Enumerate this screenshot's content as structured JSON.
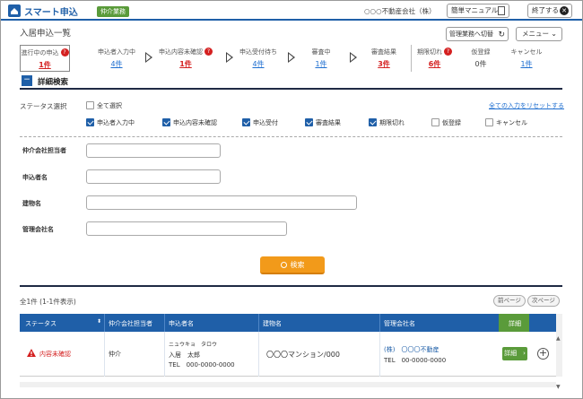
{
  "header": {
    "app_title": "スマート申込",
    "role_badge": "仲介業務",
    "company": "○○○不動産会社（株）",
    "manual_label": "簡単マニュアル",
    "exit_label": "終了する",
    "accent": "#1f5fa8"
  },
  "page": {
    "title": "入居申込一覧",
    "switch_label": "管理業務へ切替",
    "menu_label": "メニュー"
  },
  "status_tabs": [
    {
      "label": "進行中の申込",
      "count": "1件",
      "alert": true,
      "count_style": "red"
    },
    {
      "label": "申込者入力中",
      "count": "4件",
      "alert": false,
      "count_style": "link"
    },
    {
      "label": "申込内容未確認",
      "count": "1件",
      "alert": true,
      "count_style": "red"
    },
    {
      "label": "申込受付待ち",
      "count": "4件",
      "alert": false,
      "count_style": "link"
    },
    {
      "label": "審査中",
      "count": "1件",
      "alert": false,
      "count_style": "link"
    },
    {
      "label": "審査結果",
      "count": "3件",
      "alert": false,
      "count_style": "red"
    },
    {
      "label": "期限切れ",
      "count": "6件",
      "alert": true,
      "count_style": "red"
    },
    {
      "label": "仮登録",
      "count": "0件",
      "alert": false,
      "count_style": "plain"
    },
    {
      "label": "キャンセル",
      "count": "1件",
      "alert": false,
      "count_style": "link"
    }
  ],
  "alert_mark": "?",
  "detail_search": {
    "title": "詳細検索",
    "collapse_symbol": "−",
    "status_label": "ステータス選択",
    "reset_label": "全ての入力をリセットする",
    "select_all": "全て選択",
    "checkboxes": [
      {
        "label": "申込者入力中",
        "checked": true
      },
      {
        "label": "申込内容未確認",
        "checked": true
      },
      {
        "label": "申込受付",
        "checked": true
      },
      {
        "label": "審査結果",
        "checked": true
      },
      {
        "label": "期限切れ",
        "checked": true
      },
      {
        "label": "仮登録",
        "checked": false
      },
      {
        "label": "キャンセル",
        "checked": false
      }
    ],
    "fields": [
      {
        "label": "仲介会社担当者",
        "value": ""
      },
      {
        "label": "申込者名",
        "value": ""
      },
      {
        "label": "建物名",
        "value": ""
      },
      {
        "label": "管理会社名",
        "value": ""
      }
    ],
    "search_label": "検索"
  },
  "results": {
    "count_text": "全1件 (1-1件表示)",
    "prev_label": "前ページ",
    "next_label": "次ページ",
    "columns": [
      "ステータス",
      "仲介会社担当者",
      "申込者名",
      "建物名",
      "管理会社名",
      "詳細"
    ],
    "sort_symbol": "⬍",
    "rows": [
      {
        "status": "内容未確認",
        "agent": "仲介",
        "applicant_kana": "ニュウキョ　タロウ",
        "applicant_name": "入居　太郎",
        "applicant_tel": "TEL　000-0000-0000",
        "building": "〇〇〇マンション/000",
        "mgmt_name": "(株)　〇〇〇不動産",
        "mgmt_tel": "TEL　00-0000-0000",
        "detail_label": "詳細　›"
      }
    ]
  }
}
